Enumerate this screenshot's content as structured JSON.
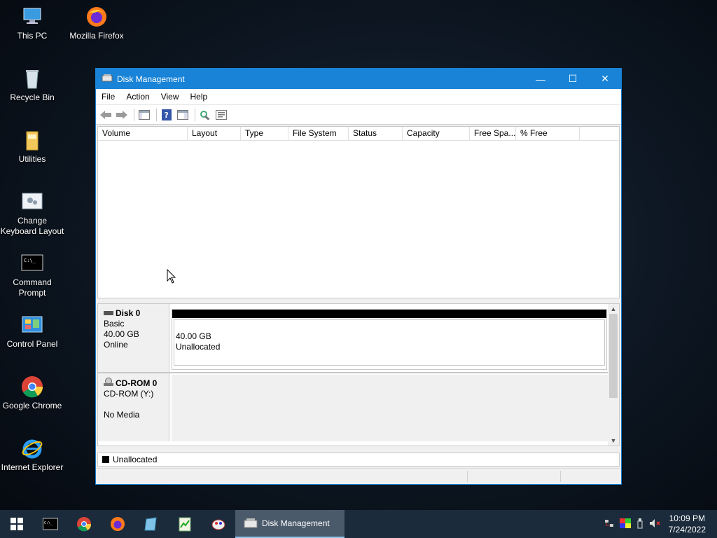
{
  "desktop": {
    "icons": [
      {
        "label": "This PC"
      },
      {
        "label": "Mozilla Firefox"
      },
      {
        "label": "Recycle Bin"
      },
      {
        "label": "Utilities"
      },
      {
        "label": "Change Keyboard Layout"
      },
      {
        "label": "Command Prompt"
      },
      {
        "label": "Control Panel"
      },
      {
        "label": "Google Chrome"
      },
      {
        "label": "Internet Explorer"
      }
    ]
  },
  "window": {
    "title": "Disk Management",
    "controls": {
      "minimize": "—",
      "maximize": "☐",
      "close": "✕"
    },
    "menu": [
      "File",
      "Action",
      "View",
      "Help"
    ],
    "columns": [
      "Volume",
      "Layout",
      "Type",
      "File System",
      "Status",
      "Capacity",
      "Free Spa...",
      "% Free"
    ],
    "disks": [
      {
        "name": "Disk 0",
        "type": "Basic",
        "size": "40.00 GB",
        "status": "Online",
        "partition": {
          "size": "40.00 GB",
          "label": "Unallocated"
        }
      },
      {
        "name": "CD-ROM 0",
        "type": "CD-ROM (Y:)",
        "status": "No Media"
      }
    ],
    "legend": {
      "label": "Unallocated",
      "color": "#000000"
    }
  },
  "taskbar": {
    "active_app": "Disk Management",
    "clock": {
      "time": "10:09 PM",
      "date": "7/24/2022"
    },
    "accent": "#1883d7"
  }
}
